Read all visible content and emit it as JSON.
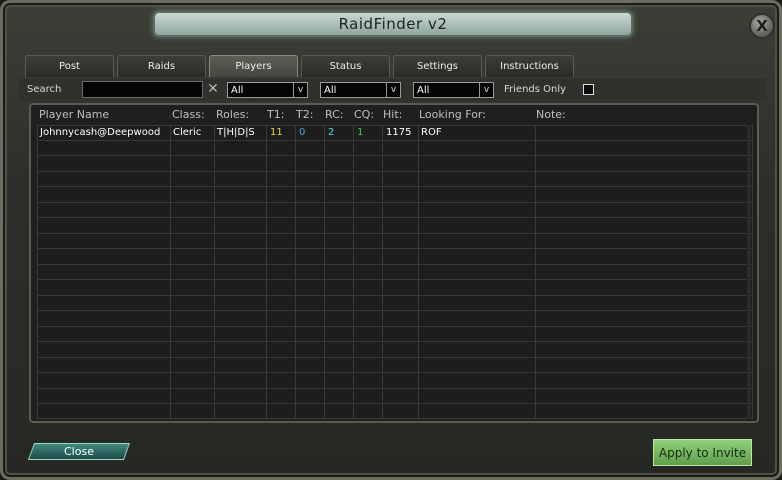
{
  "window": {
    "title": "RaidFinder v2",
    "close_glyph": "X"
  },
  "tabs": [
    {
      "label": "Post"
    },
    {
      "label": "Raids"
    },
    {
      "label": "Players"
    },
    {
      "label": "Status"
    },
    {
      "label": "Settings"
    },
    {
      "label": "Instructions"
    }
  ],
  "filters": {
    "search_label": "Search",
    "search_value": "",
    "clear_glyph": "✕",
    "dropdowns": [
      {
        "value": "All",
        "arrow": "v"
      },
      {
        "value": "All",
        "arrow": "v"
      },
      {
        "value": "All",
        "arrow": "v"
      }
    ],
    "friends_only_label": "Friends Only",
    "friends_only_checked": false
  },
  "table": {
    "headers": [
      "Player Name",
      "Class:",
      "Roles:",
      "T1:",
      "T2:",
      "RC:",
      "CQ:",
      "Hit:",
      "Looking For:",
      "Note:"
    ],
    "rows": [
      {
        "name": "Johnnycash@Deepwood",
        "class": "Cleric",
        "roles": "T|H|D|S",
        "t1": "11",
        "t2": "0",
        "rc": "2",
        "cq": "1",
        "hit": "1175",
        "looking_for": "ROF",
        "note": ""
      }
    ],
    "value_colors": {
      "t1": "#e8d53a",
      "t2": "#3fa9d6",
      "rc": "#4fd6e0",
      "cq": "#3fd24a"
    }
  },
  "buttons": {
    "close": "Close",
    "apply": "Apply to Invite"
  }
}
